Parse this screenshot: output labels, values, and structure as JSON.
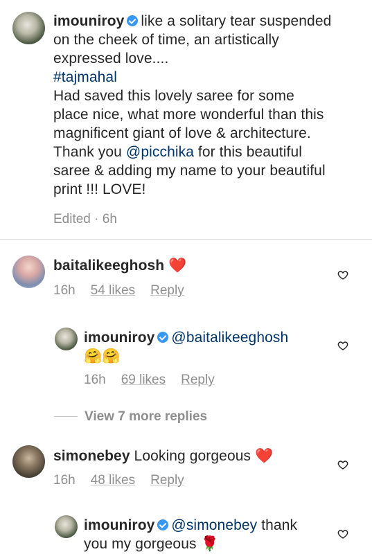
{
  "caption": {
    "username": "imouniroy",
    "text_line1": "like a solitary tear suspended",
    "text_line2": "on the cheek of time, an artistically",
    "text_line3": "expressed love....",
    "hashtag": "#tajmahal",
    "body_line1": "Had saved this lovely saree for some",
    "body_line2": "place nice, what more wonderful than this",
    "body_line3": "magnificent giant of love & architecture.",
    "body_line4_pre": "Thank you ",
    "body_line4_mention": "@picchika",
    "body_line4_post": " for this beautiful",
    "body_line5": "saree & adding my name to your beautiful",
    "body_line6": "print !!! LOVE!",
    "edited": "Edited · 6h"
  },
  "comments": [
    {
      "username": "baitalikeeghosh",
      "text": "❤️",
      "time": "16h",
      "likes": "54 likes",
      "reply": "Reply"
    },
    {
      "username": "imouniroy",
      "mention": "@baitalikeeghosh",
      "text": "🤗🤗",
      "time": "16h",
      "likes": "69 likes",
      "reply": "Reply"
    },
    {
      "username": "simonebey",
      "text": "Looking gorgeous",
      "heart": "❤️",
      "time": "16h",
      "likes": "48 likes",
      "reply": "Reply"
    },
    {
      "username": "imouniroy",
      "mention": "@simonebey",
      "text_line1": "thank",
      "text_line2": "you my gorgeous",
      "emoji": "🌹"
    }
  ],
  "view_more": "View 7 more replies",
  "icons": {
    "verified": "verified-badge-icon",
    "like": "heart-outline-icon"
  }
}
